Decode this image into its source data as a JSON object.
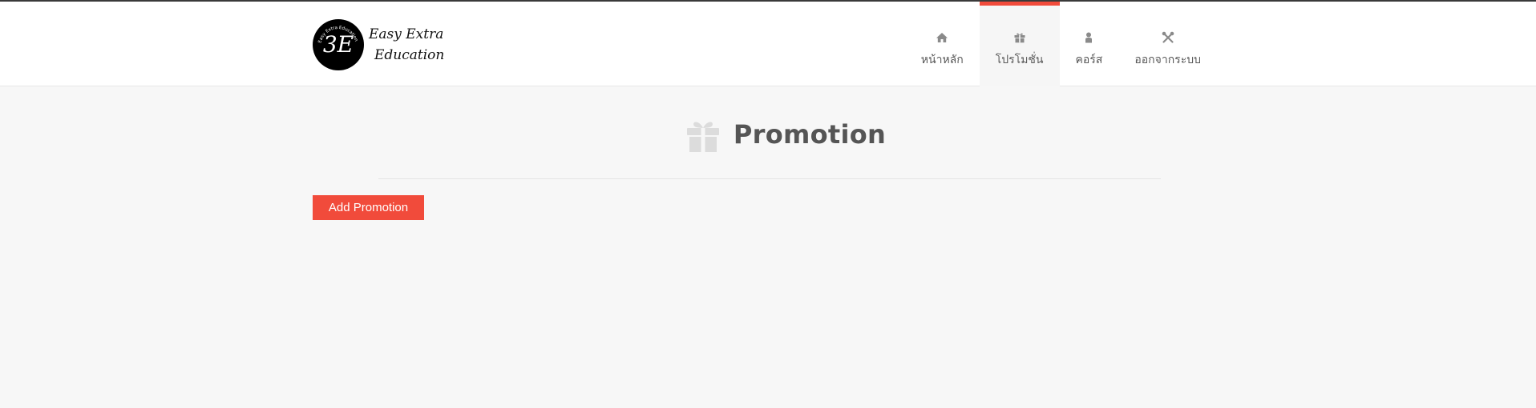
{
  "brand": {
    "logo_mark": "3E",
    "logo_ring_text": "Easy Extra Education",
    "name_line1": "Easy Extra",
    "name_line2": "Education"
  },
  "nav": {
    "items": [
      {
        "label": "หน้าหลัก",
        "icon": "home-icon",
        "active": false
      },
      {
        "label": "โปรโมชั่น",
        "icon": "gift-icon",
        "active": true
      },
      {
        "label": "คอร์ส",
        "icon": "user-icon",
        "active": false
      },
      {
        "label": "ออกจากระบบ",
        "icon": "tools-icon",
        "active": false
      }
    ],
    "active_color": "#f14b3b"
  },
  "page": {
    "title": "Promotion",
    "title_icon": "gift-icon"
  },
  "actions": {
    "add_label": "Add Promotion",
    "add_color": "#f14b3b"
  }
}
